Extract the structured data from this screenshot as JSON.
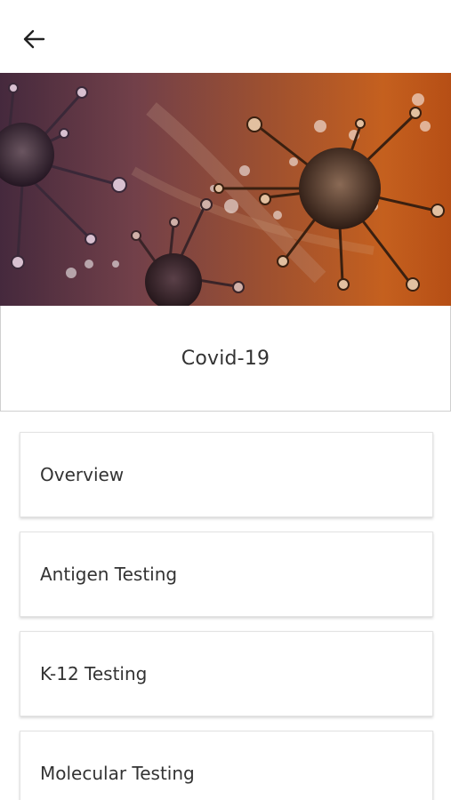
{
  "topbar": {
    "back_icon": "arrow-left-icon"
  },
  "hero": {
    "image": "coronavirus-illustration",
    "colors": {
      "left": "#3a2030",
      "right": "#c25a18"
    }
  },
  "title": "Covid-19",
  "menu": [
    {
      "label": "Overview"
    },
    {
      "label": "Antigen Testing"
    },
    {
      "label": "K-12 Testing"
    },
    {
      "label": "Molecular Testing"
    }
  ]
}
